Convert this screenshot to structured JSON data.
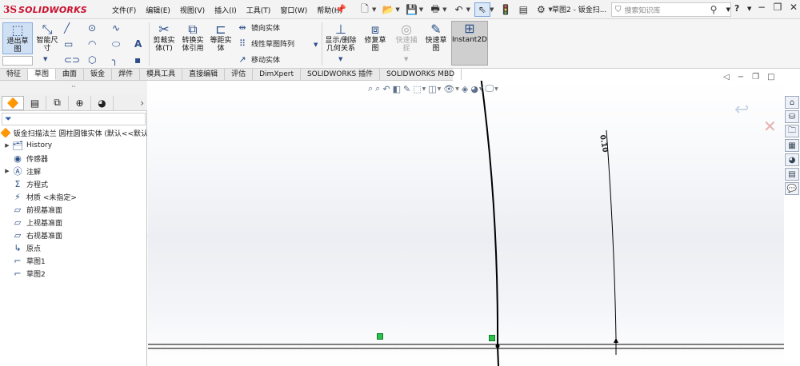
{
  "app": {
    "logo_ds": "3S",
    "logo_name": "SOLIDWORKS"
  },
  "menu": [
    "文件(F)",
    "编辑(E)",
    "视图(V)",
    "插入(I)",
    "工具(T)",
    "窗口(W)",
    "帮助(H)"
  ],
  "document_title": "草图2 - 钣金扫...",
  "search": {
    "placeholder": "搜索知识库"
  },
  "ribbon": {
    "exit_sketch": "退出草\n图",
    "smart_dim": "智能尺\n寸",
    "trim": "剪裁实\n体(T)",
    "convert": "转换实\n体引用",
    "offset": "等距实\n体",
    "mirror": "镜向实体",
    "linear_pattern": "线性草图阵列",
    "move": "移动实体",
    "display_relations": "显示/删除\n几何关系",
    "repair": "修复草\n图",
    "quick_snaps": "快速捕\n捉",
    "rapid_sketch": "快速草\n图",
    "instant2d": "Instant2D"
  },
  "tabs": [
    "特征",
    "草图",
    "曲面",
    "钣金",
    "焊件",
    "模具工具",
    "直接编辑",
    "评估",
    "DimXpert",
    "SOLIDWORKS 插件",
    "SOLIDWORKS MBD"
  ],
  "active_tab": "草图",
  "tree": {
    "root": "钣金扫描法兰 圆柱圆锥实体  (默认<<默认",
    "items": [
      {
        "label": "History",
        "icon": "history-icon",
        "expandable": true
      },
      {
        "label": "传感器",
        "icon": "sensor-icon",
        "expandable": false
      },
      {
        "label": "注解",
        "icon": "annotation-icon",
        "expandable": true
      },
      {
        "label": "方程式",
        "icon": "equation-icon",
        "expandable": false
      },
      {
        "label": "材质 <未指定>",
        "icon": "material-icon",
        "expandable": false
      },
      {
        "label": "前视基准面",
        "icon": "plane-icon",
        "expandable": false
      },
      {
        "label": "上视基准面",
        "icon": "plane-icon",
        "expandable": false
      },
      {
        "label": "右视基准面",
        "icon": "plane-icon",
        "expandable": false
      },
      {
        "label": "原点",
        "icon": "origin-icon",
        "expandable": false
      },
      {
        "label": "草图1",
        "icon": "sketch-icon",
        "expandable": false
      },
      {
        "label": "草图2",
        "icon": "sketch-icon",
        "expandable": false
      }
    ]
  },
  "graphics": {
    "dimension_label": "0.10"
  },
  "colors": {
    "accent": "#c8102e",
    "active_button": "#cfe0f4",
    "sketch_line": "#000000",
    "relation_marker": "#2cc24a"
  }
}
